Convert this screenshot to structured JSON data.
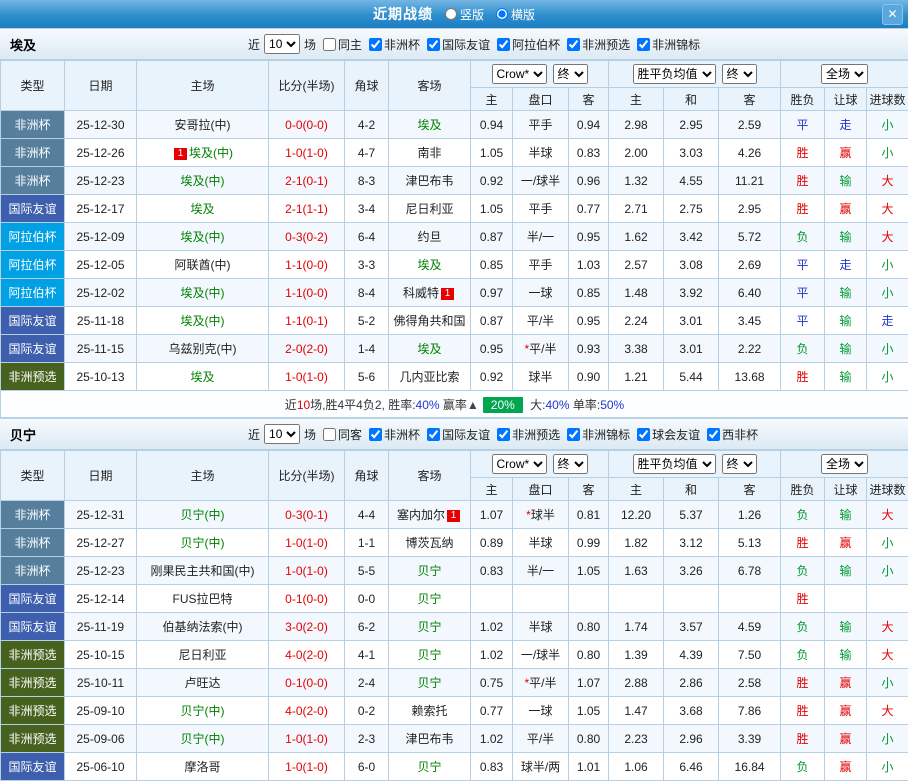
{
  "titlebar": {
    "title": "近期战绩",
    "options": [
      {
        "label": "竖版",
        "selected": false
      },
      {
        "label": "横版",
        "selected": true
      }
    ],
    "close": "✕"
  },
  "table_header": {
    "main_cols": [
      "类型",
      "日期",
      "主场",
      "比分(半场)",
      "角球",
      "客场"
    ],
    "asia_selects": [
      "Crow*",
      "终"
    ],
    "europe_selects": [
      "胜平负均值",
      "终"
    ],
    "scope_selects": [
      "全场"
    ],
    "sub_cols": [
      "主",
      "盘口",
      "客",
      "主",
      "和",
      "客",
      "胜负",
      "让球",
      "进球数"
    ]
  },
  "type_colors": {
    "非洲杯": "#567f9e",
    "国际友谊": "#3e5fae",
    "阿拉伯杯": "#00a0e4",
    "非洲预选": "#47611f"
  },
  "verdict_colors": {
    "r": "#e60000",
    "g": "#009933",
    "b": "#2233cc"
  },
  "sections": [
    {
      "team": "埃及",
      "filter": {
        "near": "近",
        "count": "10",
        "games": "场",
        "checks": [
          {
            "label": "同主",
            "checked": false
          },
          {
            "label": "非洲杯",
            "checked": true
          },
          {
            "label": "国际友谊",
            "checked": true
          },
          {
            "label": "阿拉伯杯",
            "checked": true
          },
          {
            "label": "非洲预选",
            "checked": true
          },
          {
            "label": "非洲锦标",
            "checked": true
          }
        ]
      },
      "rows": [
        {
          "type": "非洲杯",
          "date": "25-12-30",
          "home": {
            "name": "安哥拉(中)",
            "green": false
          },
          "score": "0-0(0-0)",
          "corner": "4-2",
          "away": {
            "name": "埃及",
            "green": true
          },
          "asia": [
            "0.94",
            "平手",
            "0.94"
          ],
          "europe": [
            "2.98",
            "2.95",
            "2.59"
          ],
          "verdict": [
            [
              "平",
              "b"
            ],
            [
              "走",
              "b"
            ],
            [
              "小",
              "g"
            ]
          ]
        },
        {
          "type": "非洲杯",
          "date": "25-12-26",
          "home": {
            "name": "埃及(中)",
            "green": true,
            "card_before": "1"
          },
          "score": "1-0(1-0)",
          "corner": "4-7",
          "away": {
            "name": "南非",
            "green": false
          },
          "asia": [
            "1.05",
            "半球",
            "0.83"
          ],
          "europe": [
            "2.00",
            "3.03",
            "4.26"
          ],
          "verdict": [
            [
              "胜",
              "r"
            ],
            [
              "赢",
              "r"
            ],
            [
              "小",
              "g"
            ]
          ]
        },
        {
          "type": "非洲杯",
          "date": "25-12-23",
          "home": {
            "name": "埃及(中)",
            "green": true
          },
          "score": "2-1(0-1)",
          "corner": "8-3",
          "away": {
            "name": "津巴布韦",
            "green": false
          },
          "asia": [
            "0.92",
            "一/球半",
            "0.96"
          ],
          "europe": [
            "1.32",
            "4.55",
            "11.21"
          ],
          "verdict": [
            [
              "胜",
              "r"
            ],
            [
              "输",
              "g"
            ],
            [
              "大",
              "r"
            ]
          ]
        },
        {
          "type": "国际友谊",
          "date": "25-12-17",
          "home": {
            "name": "埃及",
            "green": true
          },
          "score": "2-1(1-1)",
          "corner": "3-4",
          "away": {
            "name": "尼日利亚",
            "green": false
          },
          "asia": [
            "1.05",
            "平手",
            "0.77"
          ],
          "europe": [
            "2.71",
            "2.75",
            "2.95"
          ],
          "verdict": [
            [
              "胜",
              "r"
            ],
            [
              "赢",
              "r"
            ],
            [
              "大",
              "r"
            ]
          ]
        },
        {
          "type": "阿拉伯杯",
          "date": "25-12-09",
          "home": {
            "name": "埃及(中)",
            "green": true
          },
          "score": "0-3(0-2)",
          "corner": "6-4",
          "away": {
            "name": "约旦",
            "green": false
          },
          "asia": [
            "0.87",
            "半/一",
            "0.95"
          ],
          "europe": [
            "1.62",
            "3.42",
            "5.72"
          ],
          "verdict": [
            [
              "负",
              "g"
            ],
            [
              "输",
              "g"
            ],
            [
              "大",
              "r"
            ]
          ]
        },
        {
          "type": "阿拉伯杯",
          "date": "25-12-05",
          "home": {
            "name": "阿联酋(中)",
            "green": false
          },
          "score": "1-1(0-0)",
          "corner": "3-3",
          "away": {
            "name": "埃及",
            "green": true
          },
          "asia": [
            "0.85",
            "平手",
            "1.03"
          ],
          "europe": [
            "2.57",
            "3.08",
            "2.69"
          ],
          "verdict": [
            [
              "平",
              "b"
            ],
            [
              "走",
              "b"
            ],
            [
              "小",
              "g"
            ]
          ]
        },
        {
          "type": "阿拉伯杯",
          "date": "25-12-02",
          "home": {
            "name": "埃及(中)",
            "green": true
          },
          "score": "1-1(0-0)",
          "corner": "8-4",
          "away": {
            "name": "科威特",
            "green": false,
            "card_after": "1"
          },
          "asia": [
            "0.97",
            "一球",
            "0.85"
          ],
          "europe": [
            "1.48",
            "3.92",
            "6.40"
          ],
          "verdict": [
            [
              "平",
              "b"
            ],
            [
              "输",
              "g"
            ],
            [
              "小",
              "g"
            ]
          ]
        },
        {
          "type": "国际友谊",
          "date": "25-11-18",
          "home": {
            "name": "埃及(中)",
            "green": true
          },
          "score": "1-1(0-1)",
          "corner": "5-2",
          "away": {
            "name": "佛得角共和国",
            "green": false
          },
          "asia": [
            "0.87",
            "平/半",
            "0.95"
          ],
          "europe": [
            "2.24",
            "3.01",
            "3.45"
          ],
          "verdict": [
            [
              "平",
              "b"
            ],
            [
              "输",
              "g"
            ],
            [
              "走",
              "b"
            ]
          ]
        },
        {
          "type": "国际友谊",
          "date": "25-11-15",
          "home": {
            "name": "乌兹别克(中)",
            "green": false
          },
          "score": "2-0(2-0)",
          "corner": "1-4",
          "away": {
            "name": "埃及",
            "green": true
          },
          "asia": [
            "0.95",
            "*平/半",
            "0.93"
          ],
          "europe": [
            "3.38",
            "3.01",
            "2.22"
          ],
          "verdict": [
            [
              "负",
              "g"
            ],
            [
              "输",
              "g"
            ],
            [
              "小",
              "g"
            ]
          ]
        },
        {
          "type": "非洲预选",
          "date": "25-10-13",
          "home": {
            "name": "埃及",
            "green": true
          },
          "score": "1-0(1-0)",
          "corner": "5-6",
          "away": {
            "name": "几内亚比索",
            "green": false
          },
          "asia": [
            "0.92",
            "球半",
            "0.90"
          ],
          "europe": [
            "1.21",
            "5.44",
            "13.68"
          ],
          "verdict": [
            [
              "胜",
              "r"
            ],
            [
              "输",
              "g"
            ],
            [
              "小",
              "g"
            ]
          ]
        }
      ],
      "summary": [
        {
          "t": "近",
          "c": "#333333"
        },
        {
          "t": "10",
          "c": "#e60000"
        },
        {
          "t": "场,胜4平4负2, 胜率:",
          "c": "#333333"
        },
        {
          "t": "40%",
          "c": "#2233cc"
        },
        {
          "t": " 赢率",
          "c": "#333333"
        },
        {
          "t": "▲",
          "c": "#444444"
        },
        {
          "badge": "20%",
          "bg": "#00a650"
        },
        {
          "t": " 大:",
          "c": "#333333"
        },
        {
          "t": "40%",
          "c": "#2233cc"
        },
        {
          "t": " 单率:",
          "c": "#333333"
        },
        {
          "t": "50%",
          "c": "#2233cc"
        }
      ]
    },
    {
      "team": "贝宁",
      "filter": {
        "near": "近",
        "count": "10",
        "games": "场",
        "checks": [
          {
            "label": "同客",
            "checked": false
          },
          {
            "label": "非洲杯",
            "checked": true
          },
          {
            "label": "国际友谊",
            "checked": true
          },
          {
            "label": "非洲预选",
            "checked": true
          },
          {
            "label": "非洲锦标",
            "checked": true
          },
          {
            "label": "球会友谊",
            "checked": true
          },
          {
            "label": "西非杯",
            "checked": true
          }
        ]
      },
      "rows": [
        {
          "type": "非洲杯",
          "date": "25-12-31",
          "home": {
            "name": "贝宁(中)",
            "green": true
          },
          "score": "0-3(0-1)",
          "corner": "4-4",
          "away": {
            "name": "塞内加尔",
            "green": false,
            "card_after": "1"
          },
          "asia": [
            "1.07",
            "*球半",
            "0.81"
          ],
          "europe": [
            "12.20",
            "5.37",
            "1.26"
          ],
          "verdict": [
            [
              "负",
              "g"
            ],
            [
              "输",
              "g"
            ],
            [
              "大",
              "r"
            ]
          ]
        },
        {
          "type": "非洲杯",
          "date": "25-12-27",
          "home": {
            "name": "贝宁(中)",
            "green": true
          },
          "score": "1-0(1-0)",
          "corner": "1-1",
          "away": {
            "name": "博茨瓦纳",
            "green": false
          },
          "asia": [
            "0.89",
            "半球",
            "0.99"
          ],
          "europe": [
            "1.82",
            "3.12",
            "5.13"
          ],
          "verdict": [
            [
              "胜",
              "r"
            ],
            [
              "赢",
              "r"
            ],
            [
              "小",
              "g"
            ]
          ]
        },
        {
          "type": "非洲杯",
          "date": "25-12-23",
          "home": {
            "name": "刚果民主共和国(中)",
            "green": false
          },
          "score": "1-0(1-0)",
          "corner": "5-5",
          "away": {
            "name": "贝宁",
            "green": true
          },
          "asia": [
            "0.83",
            "半/一",
            "1.05"
          ],
          "europe": [
            "1.63",
            "3.26",
            "6.78"
          ],
          "verdict": [
            [
              "负",
              "g"
            ],
            [
              "输",
              "g"
            ],
            [
              "小",
              "g"
            ]
          ]
        },
        {
          "type": "国际友谊",
          "date": "25-12-14",
          "home": {
            "name": "FUS拉巴特",
            "green": false
          },
          "score": "0-1(0-0)",
          "corner": "0-0",
          "away": {
            "name": "贝宁",
            "green": true
          },
          "asia": [
            "",
            "",
            ""
          ],
          "europe": [
            "",
            "",
            ""
          ],
          "verdict": [
            [
              "胜",
              "r"
            ],
            [
              "",
              ""
            ],
            [
              "",
              ""
            ]
          ]
        },
        {
          "type": "国际友谊",
          "date": "25-11-19",
          "home": {
            "name": "伯基纳法索(中)",
            "green": false
          },
          "score": "3-0(2-0)",
          "corner": "6-2",
          "away": {
            "name": "贝宁",
            "green": true
          },
          "asia": [
            "1.02",
            "半球",
            "0.80"
          ],
          "europe": [
            "1.74",
            "3.57",
            "4.59"
          ],
          "verdict": [
            [
              "负",
              "g"
            ],
            [
              "输",
              "g"
            ],
            [
              "大",
              "r"
            ]
          ]
        },
        {
          "type": "非洲预选",
          "date": "25-10-15",
          "home": {
            "name": "尼日利亚",
            "green": false
          },
          "score": "4-0(2-0)",
          "corner": "4-1",
          "away": {
            "name": "贝宁",
            "green": true
          },
          "asia": [
            "1.02",
            "一/球半",
            "0.80"
          ],
          "europe": [
            "1.39",
            "4.39",
            "7.50"
          ],
          "verdict": [
            [
              "负",
              "g"
            ],
            [
              "输",
              "g"
            ],
            [
              "大",
              "r"
            ]
          ]
        },
        {
          "type": "非洲预选",
          "date": "25-10-11",
          "home": {
            "name": "卢旺达",
            "green": false
          },
          "score": "0-1(0-0)",
          "corner": "2-4",
          "away": {
            "name": "贝宁",
            "green": true
          },
          "asia": [
            "0.75",
            "*平/半",
            "1.07"
          ],
          "europe": [
            "2.88",
            "2.86",
            "2.58"
          ],
          "verdict": [
            [
              "胜",
              "r"
            ],
            [
              "赢",
              "r"
            ],
            [
              "小",
              "g"
            ]
          ]
        },
        {
          "type": "非洲预选",
          "date": "25-09-10",
          "home": {
            "name": "贝宁(中)",
            "green": true
          },
          "score": "4-0(2-0)",
          "corner": "0-2",
          "away": {
            "name": "赖索托",
            "green": false
          },
          "asia": [
            "0.77",
            "一球",
            "1.05"
          ],
          "europe": [
            "1.47",
            "3.68",
            "7.86"
          ],
          "verdict": [
            [
              "胜",
              "r"
            ],
            [
              "赢",
              "r"
            ],
            [
              "大",
              "r"
            ]
          ]
        },
        {
          "type": "非洲预选",
          "date": "25-09-06",
          "home": {
            "name": "贝宁(中)",
            "green": true
          },
          "score": "1-0(1-0)",
          "corner": "2-3",
          "away": {
            "name": "津巴布韦",
            "green": false
          },
          "asia": [
            "1.02",
            "平/半",
            "0.80"
          ],
          "europe": [
            "2.23",
            "2.96",
            "3.39"
          ],
          "verdict": [
            [
              "胜",
              "r"
            ],
            [
              "赢",
              "r"
            ],
            [
              "小",
              "g"
            ]
          ]
        },
        {
          "type": "国际友谊",
          "date": "25-06-10",
          "home": {
            "name": "摩洛哥",
            "green": false
          },
          "score": "1-0(1-0)",
          "corner": "6-0",
          "away": {
            "name": "贝宁",
            "green": true
          },
          "asia": [
            "0.83",
            "球半/两",
            "1.01"
          ],
          "europe": [
            "1.06",
            "6.46",
            "16.84"
          ],
          "verdict": [
            [
              "负",
              "g"
            ],
            [
              "赢",
              "r"
            ],
            [
              "小",
              "g"
            ]
          ]
        }
      ],
      "summary": null
    }
  ]
}
